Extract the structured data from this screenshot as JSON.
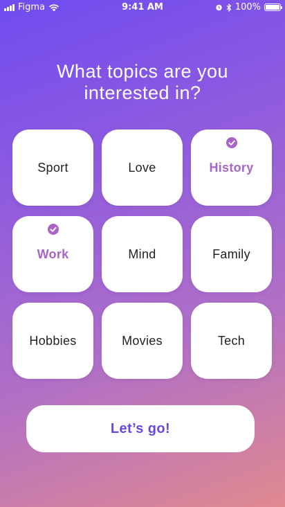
{
  "status_bar": {
    "carrier": "Figma",
    "time": "9:41 AM",
    "battery": "100%",
    "battery_level": 1.0
  },
  "title": {
    "line1": "What topics are you",
    "line2": "interested in?"
  },
  "topics": [
    {
      "label": "Sport",
      "selected": false
    },
    {
      "label": "Love",
      "selected": false
    },
    {
      "label": "History",
      "selected": true
    },
    {
      "label": "Work",
      "selected": true
    },
    {
      "label": "Mind",
      "selected": false
    },
    {
      "label": "Family",
      "selected": false
    },
    {
      "label": "Hobbies",
      "selected": false
    },
    {
      "label": "Movies",
      "selected": false
    },
    {
      "label": "Tech",
      "selected": false
    }
  ],
  "cta": {
    "label": "Let’s go!"
  },
  "colors": {
    "accent": "#a864c8",
    "cta_text": "#6a45e6",
    "gradient_top": "#6f4bf0",
    "gradient_bottom": "#e0898f"
  },
  "icons": {
    "check": "check-icon",
    "signal": "signal-icon",
    "wifi": "wifi-icon",
    "alarm": "alarm-icon",
    "bluetooth": "bluetooth-icon",
    "battery": "battery-icon"
  }
}
